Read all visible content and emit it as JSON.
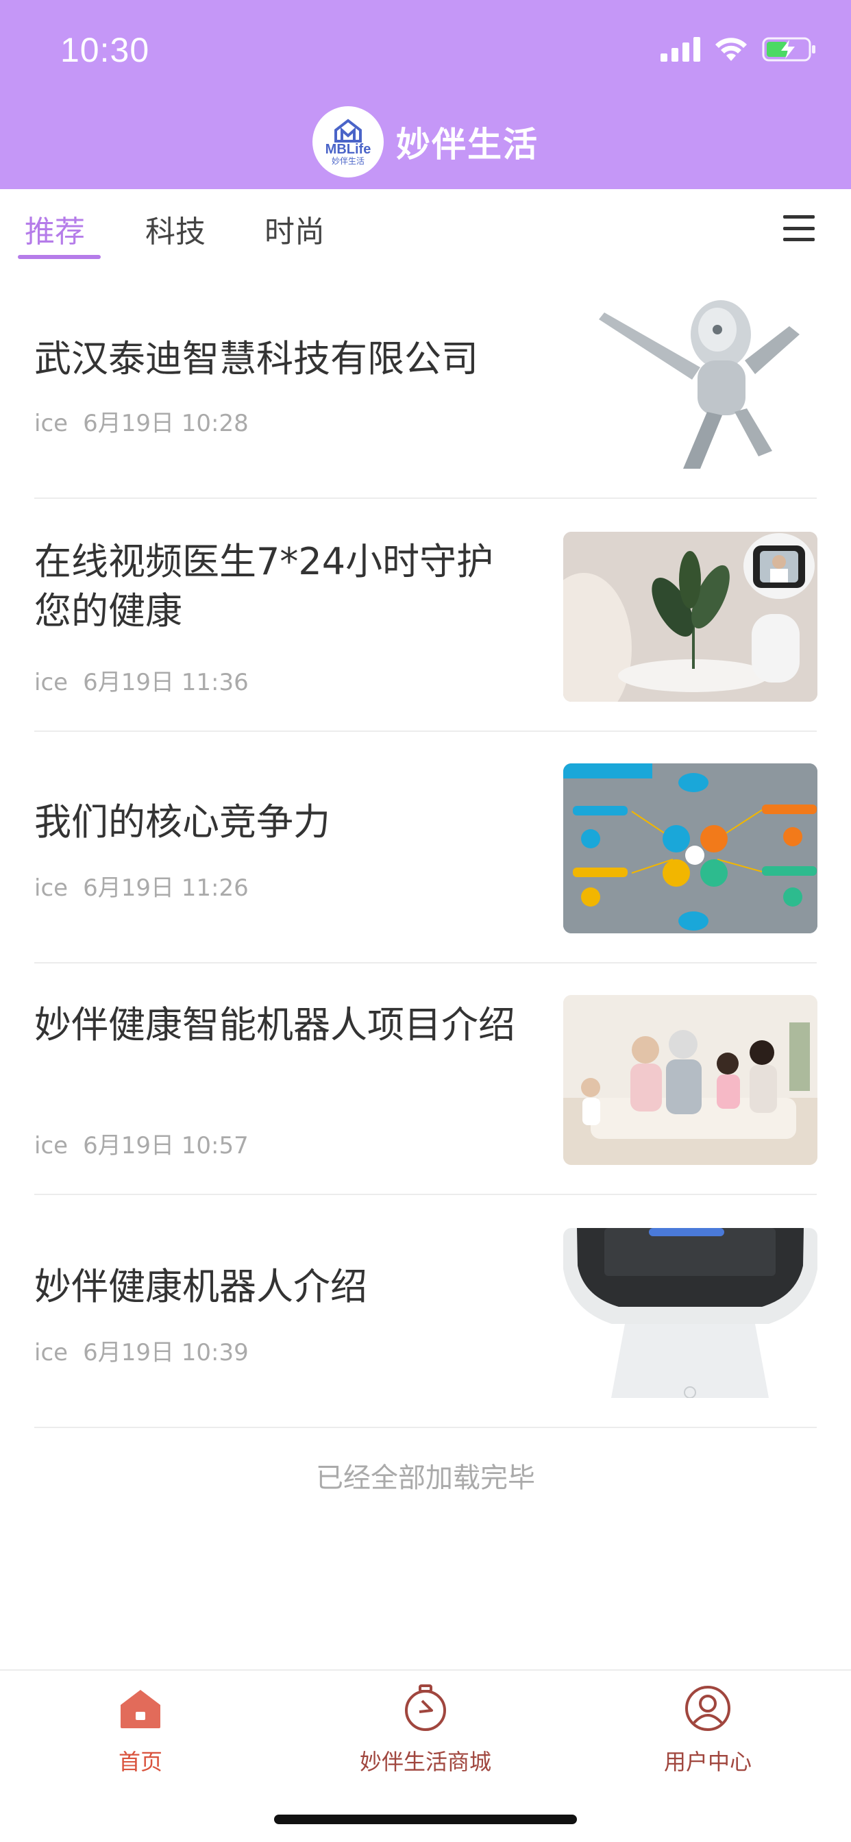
{
  "status_bar": {
    "time": "10:30"
  },
  "header": {
    "app_title": "妙伴生活",
    "logo_text": "MBLife",
    "logo_subtext": "妙伴生活"
  },
  "tabs": [
    {
      "label": "推荐",
      "active": true
    },
    {
      "label": "科技",
      "active": false
    },
    {
      "label": "时尚",
      "active": false
    }
  ],
  "articles": [
    {
      "title": "武汉泰迪智慧科技有限公司",
      "author": "ice",
      "date": "6月19日 10:28",
      "image": "robot-runner"
    },
    {
      "title": "在线视频医生7*24小时守护您的健康",
      "author": "ice",
      "date": "6月19日 11:36",
      "image": "video-doctor-robot"
    },
    {
      "title": "我们的核心竞争力",
      "author": "ice",
      "date": "6月19日 11:26",
      "image": "solution-diagram"
    },
    {
      "title": "妙伴健康智能机器人项目介绍",
      "author": "ice",
      "date": "6月19日 10:57",
      "image": "family-photo"
    },
    {
      "title": "妙伴健康机器人介绍",
      "author": "ice",
      "date": "6月19日 10:39",
      "image": "white-robot"
    }
  ],
  "list_footer": "已经全部加载完毕",
  "bottom_nav": [
    {
      "label": "首页",
      "icon": "home-icon",
      "active": true
    },
    {
      "label": "妙伴生活商城",
      "icon": "stopwatch-icon",
      "active": false
    },
    {
      "label": "用户中心",
      "icon": "user-icon",
      "active": false
    }
  ],
  "colors": {
    "header_bg": "#c597f7",
    "accent": "#b57ce9",
    "nav_active": "#d9533d",
    "nav_inactive": "#a0463e"
  }
}
